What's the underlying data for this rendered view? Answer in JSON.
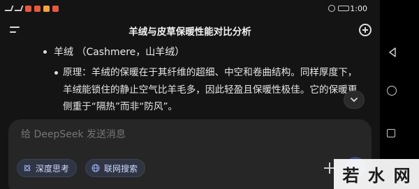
{
  "status_bar": {
    "time": "1:00"
  },
  "header": {
    "title": "羊绒与皮草保暖性能对比分析"
  },
  "message": {
    "heading": "羊绒 （Cashmere，山羊绒）",
    "principle": "原理：羊绒的保暖在于其纤维的超细、中空和卷曲结构。同样厚度下，羊绒能锁住的静止空气比羊毛多，因此轻盈且保暖性极佳。它的保暖更侧重于“隔热”而非“防风”。"
  },
  "composer": {
    "placeholder": "给 DeepSeek 发送消息",
    "chip_deep_think": "深度思考",
    "chip_web_search": "联网搜索"
  },
  "watermark": {
    "chars": [
      "若",
      "水",
      "网"
    ]
  },
  "colors": {
    "background": "#141414",
    "chip_bg": "#2f3542",
    "chip_text": "#cfd8ff",
    "send_button": "#3c4a7a"
  }
}
